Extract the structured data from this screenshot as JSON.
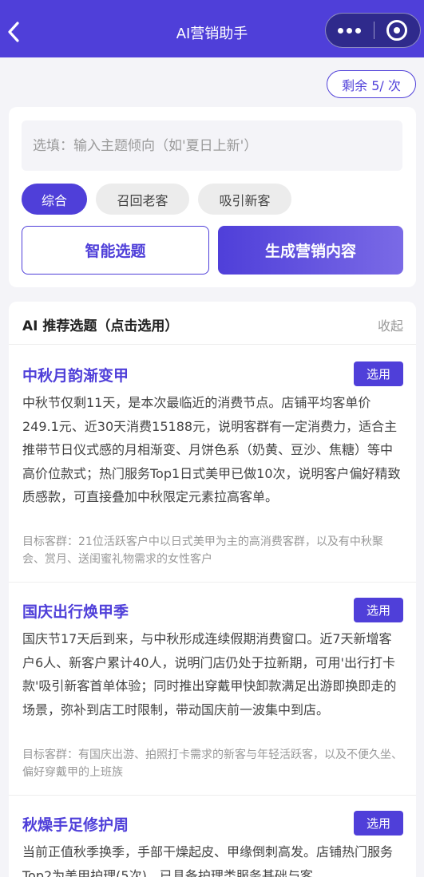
{
  "navbar": {
    "title": "AI营销助手",
    "back_icon": "chevron-left-icon",
    "more_icon": "more-dots-icon",
    "close_icon": "target-circle-icon",
    "background": "#4f3fd9"
  },
  "quota": {
    "label": "剩余 5/ 次"
  },
  "topic_form": {
    "placeholder": "选填：输入主题倾向（如'夏日上新'）",
    "value": "",
    "chips": [
      {
        "label": "综合",
        "selected": true
      },
      {
        "label": "召回老客",
        "selected": false
      },
      {
        "label": "吸引新客",
        "selected": false
      }
    ],
    "smart_button": "智能选题",
    "generate_button": "生成营销内容"
  },
  "recommend": {
    "title": "AI 推荐选题（点击选用）",
    "collapse_label": "收起",
    "items": [
      {
        "title": "中秋月韵渐变甲",
        "pick_label": "选用",
        "body": "中秋节仅剩11天，是本次最临近的消费节点。店铺平均客单价249.1元、近30天消费15188元，说明客群有一定消费力，适合主推带节日仪式感的月相渐变、月饼色系（奶黄、豆沙、焦糖）等中高价位款式；热门服务Top1日式美甲已做10次，说明客户偏好精致质感款，可直接叠加中秋限定元素拉高客单。",
        "target": "目标客群：21位活跃客户中以日式美甲为主的高消费客群，以及有中秋聚会、赏月、送闺蜜礼物需求的女性客户"
      },
      {
        "title": "国庆出行焕甲季",
        "pick_label": "选用",
        "body": "国庆节17天后到来，与中秋形成连续假期消费窗口。近7天新增客户6人、新客户累计40人，说明门店仍处于拉新期，可用'出行打卡款'吸引新客首单体验；同时推出穿戴甲快卸款满足出游即换即走的场景，弥补到店工时限制，带动国庆前一波集中到店。",
        "target": "目标客群：有国庆出游、拍照打卡需求的新客与年轻活跃客，以及不便久坐、偏好穿戴甲的上班族"
      },
      {
        "title": "秋燥手足修护周",
        "pick_label": "选用",
        "body": "当前正值秋季换季，手部干燥起皮、甲缘倒刺高发。店铺热门服务Top2为美甲护理(5次)，已具备护理类服务基础与客",
        "target": ""
      }
    ]
  }
}
